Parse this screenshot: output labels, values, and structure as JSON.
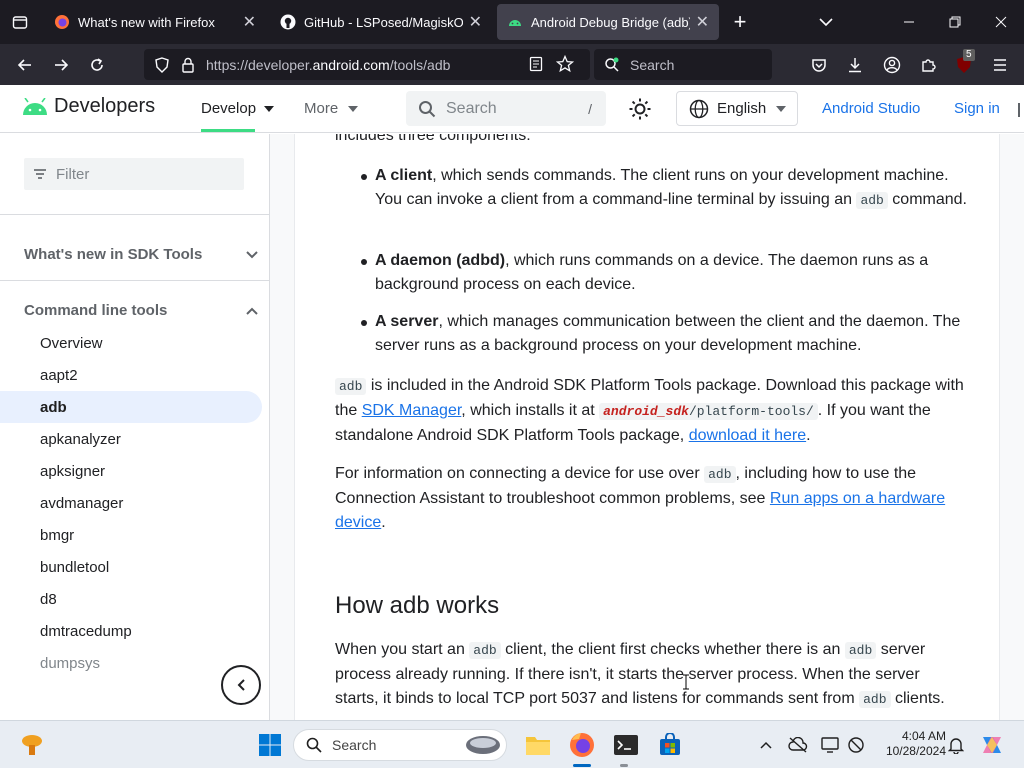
{
  "browser": {
    "tabs": [
      {
        "title": "What's new with Firefox",
        "icon": "firefox-icon",
        "active": false
      },
      {
        "title": "GitHub - LSPosed/MagiskOnWSA",
        "icon": "github-icon",
        "active": false
      },
      {
        "title": "Android Debug Bridge (adb) | A",
        "icon": "android-icon",
        "active": true
      }
    ],
    "url_host_prefix": "https://developer.",
    "url_host": "android.com",
    "url_path": "/tools/adb",
    "search_placeholder": "Search",
    "extension_badge": "5"
  },
  "site": {
    "logo_text": "Developers",
    "nav": [
      {
        "label": "Develop",
        "active": true
      },
      {
        "label": "More",
        "active": false
      }
    ],
    "search_placeholder": "Search",
    "search_shortcut": "/",
    "language": "English",
    "android_studio": "Android Studio",
    "sign_in": "Sign in"
  },
  "sidebar": {
    "filter_placeholder": "Filter",
    "section1": "What's new in SDK Tools",
    "section2": "Command line tools",
    "items": [
      {
        "label": "Overview"
      },
      {
        "label": "aapt2"
      },
      {
        "label": "adb"
      },
      {
        "label": "apkanalyzer"
      },
      {
        "label": "apksigner"
      },
      {
        "label": "avdmanager"
      },
      {
        "label": "bmgr"
      },
      {
        "label": "bundletool"
      },
      {
        "label": "d8"
      },
      {
        "label": "dmtracedump"
      },
      {
        "label": "dumpsys"
      }
    ]
  },
  "content": {
    "intro_tail": "includes three components:",
    "b1": {
      "bold": "A client",
      "t1": ", which sends commands. The client runs on your development machine. You can invoke a client from a command-line terminal by issuing an ",
      "code": "adb",
      "t2": " command."
    },
    "b2": {
      "bold": "A daemon (adbd)",
      "t1": ", which runs commands on a device. The daemon runs as a background process on each device."
    },
    "b3": {
      "bold": "A server",
      "t1": ", which manages communication between the client and the daemon. The server runs as a background process on your development machine."
    },
    "p1": {
      "code1": "adb",
      "t1": " is included in the Android SDK Platform Tools package. Download this package with the ",
      "link1": "SDK Manager",
      "t2": ", which installs it at ",
      "code_var": "android_sdk",
      "code_path": "/platform-tools/",
      "t3": ". If you want the standalone Android SDK Platform Tools package, ",
      "link2": "download it here",
      "t4": "."
    },
    "p2": {
      "t1": "For information on connecting a device for use over ",
      "code": "adb",
      "t2": ", including how to use the Connection Assistant to troubleshoot common problems, see ",
      "link": "Run apps on a hardware device",
      "t3": "."
    },
    "heading": "How adb works",
    "p3": {
      "t1": "When you start an ",
      "code1": "adb",
      "t2": " client, the client first checks whether there is an ",
      "code2": "adb",
      "t3": " server process already running. If there isn't, it starts the server process. When the server starts, it binds to local TCP port 5037 and listens for commands sent from ",
      "code3": "adb",
      "t4": " clients."
    }
  },
  "taskbar": {
    "search_placeholder": "Search",
    "time": "4:04 AM",
    "date": "10/28/2024"
  }
}
